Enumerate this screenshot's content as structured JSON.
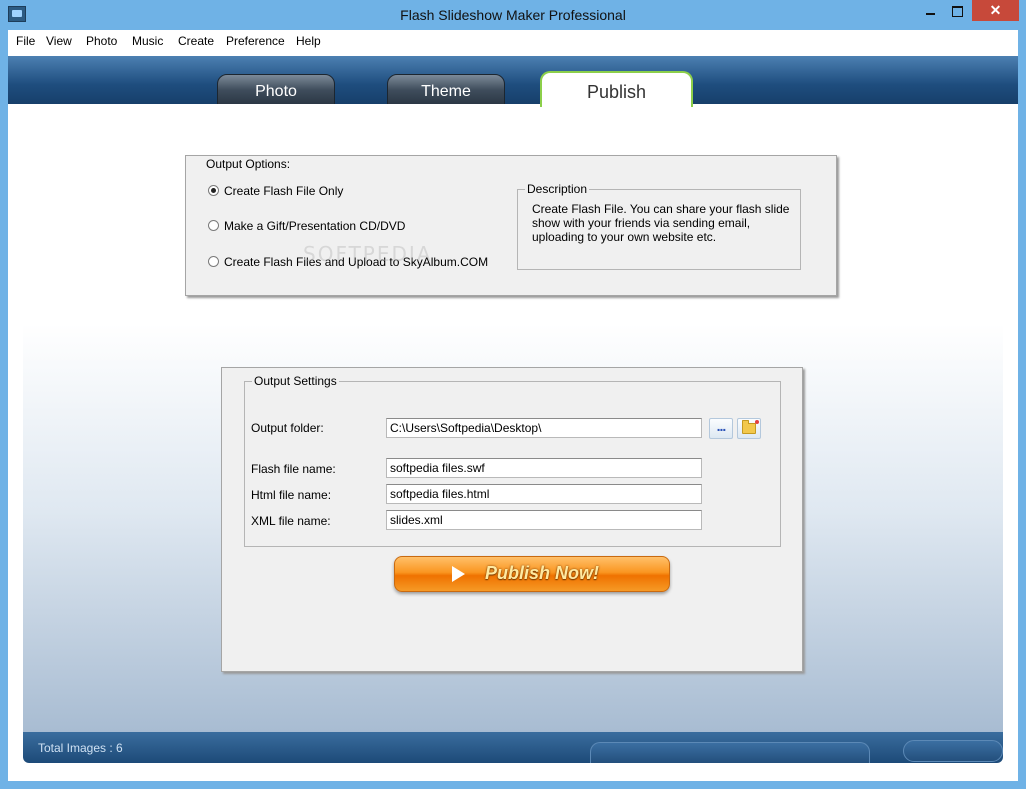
{
  "window": {
    "title": "Flash Slideshow Maker Professional"
  },
  "menu": [
    "File",
    "View",
    "Photo",
    "Music",
    "Create",
    "Preference",
    "Help"
  ],
  "tabs": {
    "photo": "Photo",
    "theme": "Theme",
    "publish": "Publish"
  },
  "output_options": {
    "legend": "Output Options:",
    "options": [
      "Create Flash File Only",
      "Make a Gift/Presentation CD/DVD",
      "Create Flash Files and Upload to  SkyAlbum.COM"
    ],
    "selected": 0,
    "description_legend": "Description",
    "description": "Create Flash File. You can share your flash slide show with your friends via sending email, uploading to your own website etc."
  },
  "output_settings": {
    "legend": "Output Settings",
    "folder_label": "Output folder:",
    "folder_value": "C:\\Users\\Softpedia\\Desktop\\",
    "browse_label": "...",
    "flash_label": "Flash file name:",
    "flash_value": "softpedia files.swf",
    "html_label": "Html file name:",
    "html_value": "softpedia files.html",
    "xml_label": "XML file name:",
    "xml_value": "slides.xml"
  },
  "publish_button": "Publish Now!",
  "status": {
    "total_images": "Total Images : 6"
  },
  "watermark": "SOFTPEDIA"
}
